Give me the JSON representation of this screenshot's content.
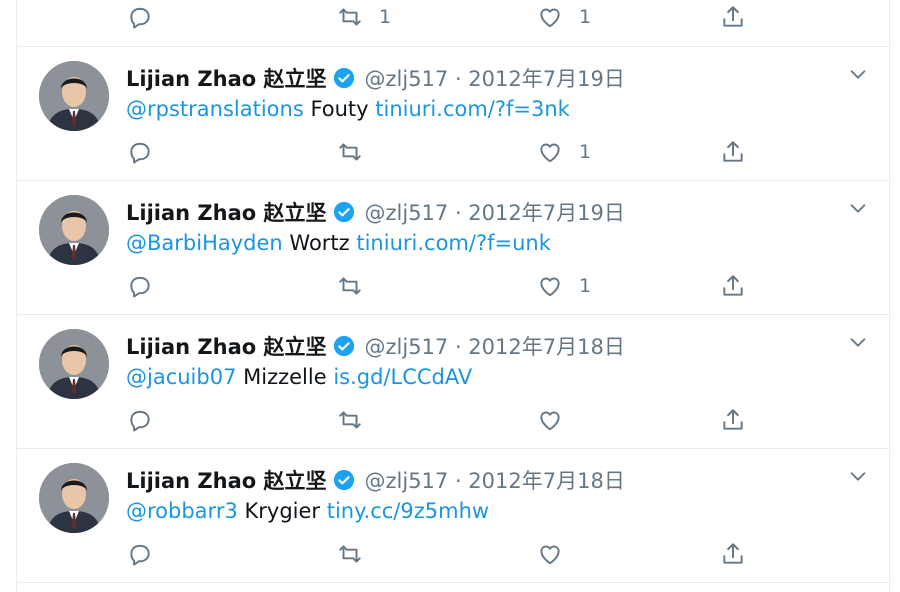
{
  "colors": {
    "link": "#1b95e0",
    "muted": "#657786",
    "verified": "#1da1f2",
    "border": "#e6ecf0"
  },
  "top_actions": {
    "reply_count": "",
    "retweet_count": "1",
    "like_count": "1"
  },
  "tweets": [
    {
      "name": "Lijian Zhao 赵立坚",
      "handle": "@zlj517 · 2012年7月19日",
      "mention": "@rpstranslations",
      "text": " Fouty ",
      "link": "tiniuri.com/?f=3nk",
      "retweet_count": "",
      "like_count": "1"
    },
    {
      "name": "Lijian Zhao 赵立坚",
      "handle": "@zlj517 · 2012年7月19日",
      "mention": "@BarbiHayden",
      "text": " Wortz ",
      "link": "tiniuri.com/?f=unk",
      "retweet_count": "",
      "like_count": "1"
    },
    {
      "name": "Lijian Zhao 赵立坚",
      "handle": "@zlj517 · 2012年7月18日",
      "mention": "@jacuib07",
      "text": " Mizzelle ",
      "link": "is.gd/LCCdAV",
      "retweet_count": "",
      "like_count": ""
    },
    {
      "name": "Lijian Zhao 赵立坚",
      "handle": "@zlj517 · 2012年7月18日",
      "mention": "@robbarr3",
      "text": " Krygier ",
      "link": "tiny.cc/9z5mhw",
      "retweet_count": "",
      "like_count": ""
    }
  ]
}
